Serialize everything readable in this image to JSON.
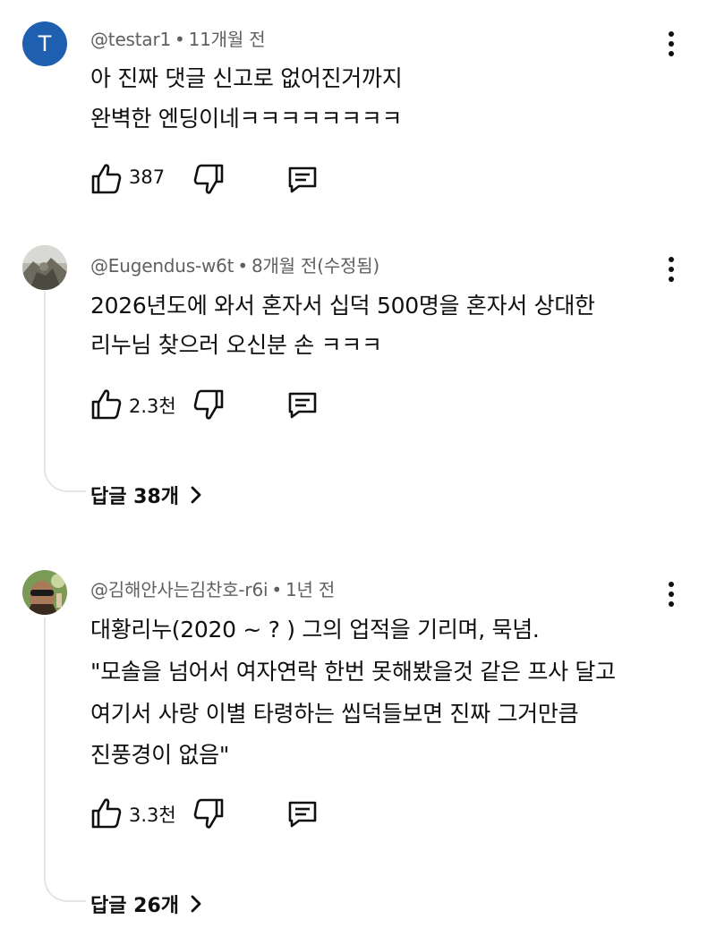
{
  "comments": [
    {
      "handle": "@testar1",
      "time": "11개월 전",
      "avatar_letter": "T",
      "lines": [
        "아 진짜 댓글 신고로 없어진거까지",
        "완벽한 엔딩이네ㅋㅋㅋㅋㅋㅋㅋㅋ"
      ],
      "likes": "387"
    },
    {
      "handle": "@Eugendus-w6t",
      "time": "8개월 전(수정됨)",
      "lines": [
        "2026년도에 와서 혼자서 십덕 500명을 혼자서 상대한",
        "리누님 찾으러 오신분 손 ㅋㅋㅋ"
      ],
      "likes": "2.3천",
      "replies": "답글 38개"
    },
    {
      "handle": "@김해안사는김찬호-r6i",
      "time": "1년 전",
      "lines": [
        "대황리누(2020 ~ ? ) 그의 업적을 기리며, 묵념.",
        "\"모솔을 넘어서 여자연락 한번 못해봤을것 같은 프사 달고",
        "여기서 사랑 이별 타령하는 씹덕들보면 진짜 그거만큼",
        "진풍경이 없음\""
      ],
      "likes": "3.3천",
      "replies": "답글 26개"
    }
  ],
  "meta_separator": "•",
  "icons": {
    "like": "thumbs-up-icon",
    "dislike": "thumbs-down-icon",
    "reply": "comment-reply-icon",
    "more": "more-vert-icon",
    "chevron": "chevron-right-icon"
  },
  "colors": {
    "avatar_accent": "#1f5fb0",
    "meta_text": "#606060",
    "thread_line": "#e5e5e5"
  }
}
